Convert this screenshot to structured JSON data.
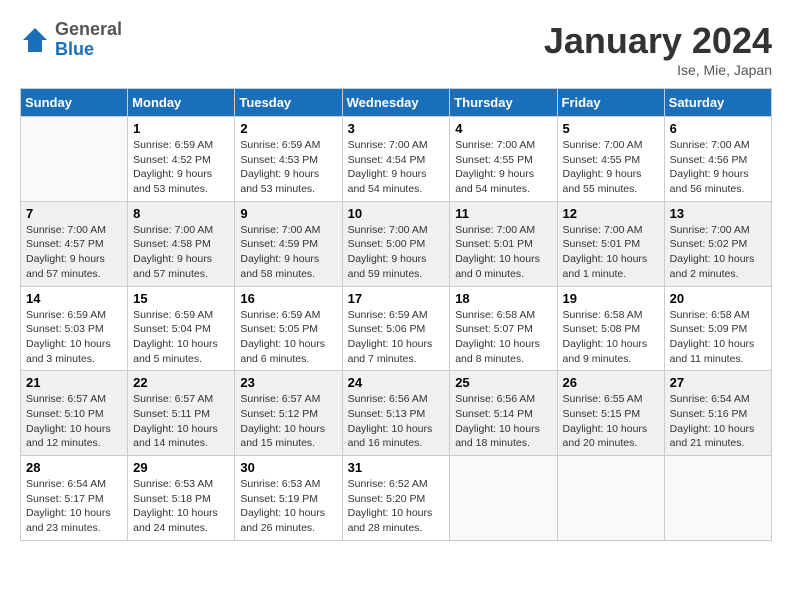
{
  "header": {
    "logo": {
      "general": "General",
      "blue": "Blue"
    },
    "title": "January 2024",
    "location": "Ise, Mie, Japan"
  },
  "calendar": {
    "days_of_week": [
      "Sunday",
      "Monday",
      "Tuesday",
      "Wednesday",
      "Thursday",
      "Friday",
      "Saturday"
    ],
    "weeks": [
      [
        {
          "day": "",
          "empty": true
        },
        {
          "day": "1",
          "sunrise": "Sunrise: 6:59 AM",
          "sunset": "Sunset: 4:52 PM",
          "daylight": "Daylight: 9 hours and 53 minutes."
        },
        {
          "day": "2",
          "sunrise": "Sunrise: 6:59 AM",
          "sunset": "Sunset: 4:53 PM",
          "daylight": "Daylight: 9 hours and 53 minutes."
        },
        {
          "day": "3",
          "sunrise": "Sunrise: 7:00 AM",
          "sunset": "Sunset: 4:54 PM",
          "daylight": "Daylight: 9 hours and 54 minutes."
        },
        {
          "day": "4",
          "sunrise": "Sunrise: 7:00 AM",
          "sunset": "Sunset: 4:55 PM",
          "daylight": "Daylight: 9 hours and 54 minutes."
        },
        {
          "day": "5",
          "sunrise": "Sunrise: 7:00 AM",
          "sunset": "Sunset: 4:55 PM",
          "daylight": "Daylight: 9 hours and 55 minutes."
        },
        {
          "day": "6",
          "sunrise": "Sunrise: 7:00 AM",
          "sunset": "Sunset: 4:56 PM",
          "daylight": "Daylight: 9 hours and 56 minutes."
        }
      ],
      [
        {
          "day": "7",
          "sunrise": "Sunrise: 7:00 AM",
          "sunset": "Sunset: 4:57 PM",
          "daylight": "Daylight: 9 hours and 57 minutes."
        },
        {
          "day": "8",
          "sunrise": "Sunrise: 7:00 AM",
          "sunset": "Sunset: 4:58 PM",
          "daylight": "Daylight: 9 hours and 57 minutes."
        },
        {
          "day": "9",
          "sunrise": "Sunrise: 7:00 AM",
          "sunset": "Sunset: 4:59 PM",
          "daylight": "Daylight: 9 hours and 58 minutes."
        },
        {
          "day": "10",
          "sunrise": "Sunrise: 7:00 AM",
          "sunset": "Sunset: 5:00 PM",
          "daylight": "Daylight: 9 hours and 59 minutes."
        },
        {
          "day": "11",
          "sunrise": "Sunrise: 7:00 AM",
          "sunset": "Sunset: 5:01 PM",
          "daylight": "Daylight: 10 hours and 0 minutes."
        },
        {
          "day": "12",
          "sunrise": "Sunrise: 7:00 AM",
          "sunset": "Sunset: 5:01 PM",
          "daylight": "Daylight: 10 hours and 1 minute."
        },
        {
          "day": "13",
          "sunrise": "Sunrise: 7:00 AM",
          "sunset": "Sunset: 5:02 PM",
          "daylight": "Daylight: 10 hours and 2 minutes."
        }
      ],
      [
        {
          "day": "14",
          "sunrise": "Sunrise: 6:59 AM",
          "sunset": "Sunset: 5:03 PM",
          "daylight": "Daylight: 10 hours and 3 minutes."
        },
        {
          "day": "15",
          "sunrise": "Sunrise: 6:59 AM",
          "sunset": "Sunset: 5:04 PM",
          "daylight": "Daylight: 10 hours and 5 minutes."
        },
        {
          "day": "16",
          "sunrise": "Sunrise: 6:59 AM",
          "sunset": "Sunset: 5:05 PM",
          "daylight": "Daylight: 10 hours and 6 minutes."
        },
        {
          "day": "17",
          "sunrise": "Sunrise: 6:59 AM",
          "sunset": "Sunset: 5:06 PM",
          "daylight": "Daylight: 10 hours and 7 minutes."
        },
        {
          "day": "18",
          "sunrise": "Sunrise: 6:58 AM",
          "sunset": "Sunset: 5:07 PM",
          "daylight": "Daylight: 10 hours and 8 minutes."
        },
        {
          "day": "19",
          "sunrise": "Sunrise: 6:58 AM",
          "sunset": "Sunset: 5:08 PM",
          "daylight": "Daylight: 10 hours and 9 minutes."
        },
        {
          "day": "20",
          "sunrise": "Sunrise: 6:58 AM",
          "sunset": "Sunset: 5:09 PM",
          "daylight": "Daylight: 10 hours and 11 minutes."
        }
      ],
      [
        {
          "day": "21",
          "sunrise": "Sunrise: 6:57 AM",
          "sunset": "Sunset: 5:10 PM",
          "daylight": "Daylight: 10 hours and 12 minutes."
        },
        {
          "day": "22",
          "sunrise": "Sunrise: 6:57 AM",
          "sunset": "Sunset: 5:11 PM",
          "daylight": "Daylight: 10 hours and 14 minutes."
        },
        {
          "day": "23",
          "sunrise": "Sunrise: 6:57 AM",
          "sunset": "Sunset: 5:12 PM",
          "daylight": "Daylight: 10 hours and 15 minutes."
        },
        {
          "day": "24",
          "sunrise": "Sunrise: 6:56 AM",
          "sunset": "Sunset: 5:13 PM",
          "daylight": "Daylight: 10 hours and 16 minutes."
        },
        {
          "day": "25",
          "sunrise": "Sunrise: 6:56 AM",
          "sunset": "Sunset: 5:14 PM",
          "daylight": "Daylight: 10 hours and 18 minutes."
        },
        {
          "day": "26",
          "sunrise": "Sunrise: 6:55 AM",
          "sunset": "Sunset: 5:15 PM",
          "daylight": "Daylight: 10 hours and 20 minutes."
        },
        {
          "day": "27",
          "sunrise": "Sunrise: 6:54 AM",
          "sunset": "Sunset: 5:16 PM",
          "daylight": "Daylight: 10 hours and 21 minutes."
        }
      ],
      [
        {
          "day": "28",
          "sunrise": "Sunrise: 6:54 AM",
          "sunset": "Sunset: 5:17 PM",
          "daylight": "Daylight: 10 hours and 23 minutes."
        },
        {
          "day": "29",
          "sunrise": "Sunrise: 6:53 AM",
          "sunset": "Sunset: 5:18 PM",
          "daylight": "Daylight: 10 hours and 24 minutes."
        },
        {
          "day": "30",
          "sunrise": "Sunrise: 6:53 AM",
          "sunset": "Sunset: 5:19 PM",
          "daylight": "Daylight: 10 hours and 26 minutes."
        },
        {
          "day": "31",
          "sunrise": "Sunrise: 6:52 AM",
          "sunset": "Sunset: 5:20 PM",
          "daylight": "Daylight: 10 hours and 28 minutes."
        },
        {
          "day": "",
          "empty": true
        },
        {
          "day": "",
          "empty": true
        },
        {
          "day": "",
          "empty": true
        }
      ]
    ]
  }
}
